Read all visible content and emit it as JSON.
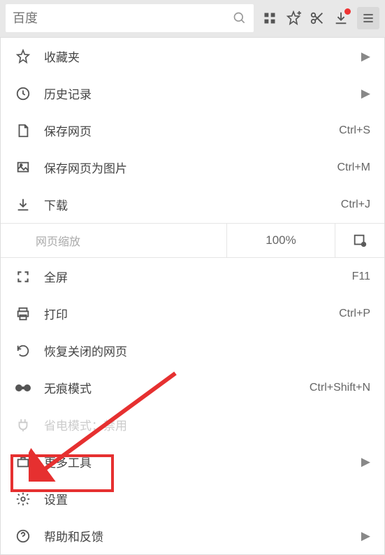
{
  "search": {
    "placeholder": "百度"
  },
  "menu": {
    "favorites": "收藏夹",
    "history": "历史记录",
    "save_page": {
      "label": "保存网页",
      "shortcut": "Ctrl+S"
    },
    "save_image": {
      "label": "保存网页为图片",
      "shortcut": "Ctrl+M"
    },
    "download": {
      "label": "下载",
      "shortcut": "Ctrl+J"
    },
    "zoom": {
      "label": "网页缩放",
      "value": "100%"
    },
    "fullscreen": {
      "label": "全屏",
      "shortcut": "F11"
    },
    "print": {
      "label": "打印",
      "shortcut": "Ctrl+P"
    },
    "restore": "恢复关闭的网页",
    "incognito": {
      "label": "无痕模式",
      "shortcut": "Ctrl+Shift+N"
    },
    "power_save": "省电模式：禁用",
    "more_tools": "更多工具",
    "settings": "设置",
    "help": "帮助和反馈"
  }
}
